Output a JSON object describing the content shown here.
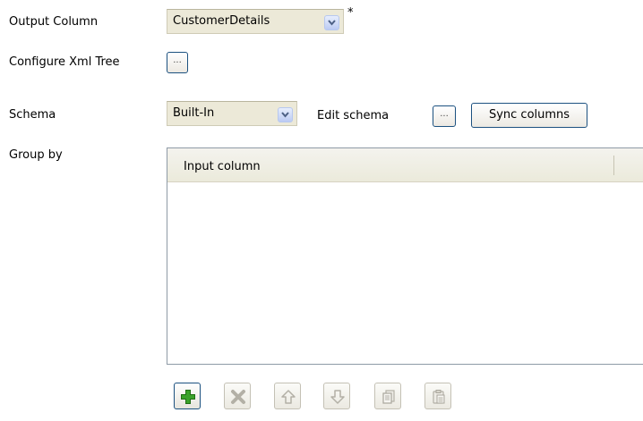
{
  "output_column": {
    "label": "Output Column",
    "value": "CustomerDetails",
    "modified_marker": "*"
  },
  "configure_xml_tree": {
    "label": "Configure Xml Tree",
    "button_label": "..."
  },
  "schema": {
    "label": "Schema",
    "value": "Built-In",
    "edit_label": "Edit schema",
    "edit_button_label": "...",
    "sync_button_label": "Sync columns"
  },
  "group_by": {
    "label": "Group by",
    "columns": [
      "Input column"
    ],
    "rows": []
  },
  "toolbar": {
    "buttons": [
      {
        "name": "add",
        "icon": "plus-icon",
        "enabled": true
      },
      {
        "name": "remove",
        "icon": "x-icon",
        "enabled": false
      },
      {
        "name": "move-up",
        "icon": "arrow-up-icon",
        "enabled": false
      },
      {
        "name": "move-down",
        "icon": "arrow-down-icon",
        "enabled": false
      },
      {
        "name": "copy",
        "icon": "copy-icon",
        "enabled": false
      },
      {
        "name": "paste",
        "icon": "paste-icon",
        "enabled": false
      }
    ]
  },
  "colors": {
    "button_border": "#1c5180",
    "combo_bg": "#ece9d8",
    "add_icon_green": "#3aa22a",
    "disabled_icon": "#b3b0a6"
  }
}
